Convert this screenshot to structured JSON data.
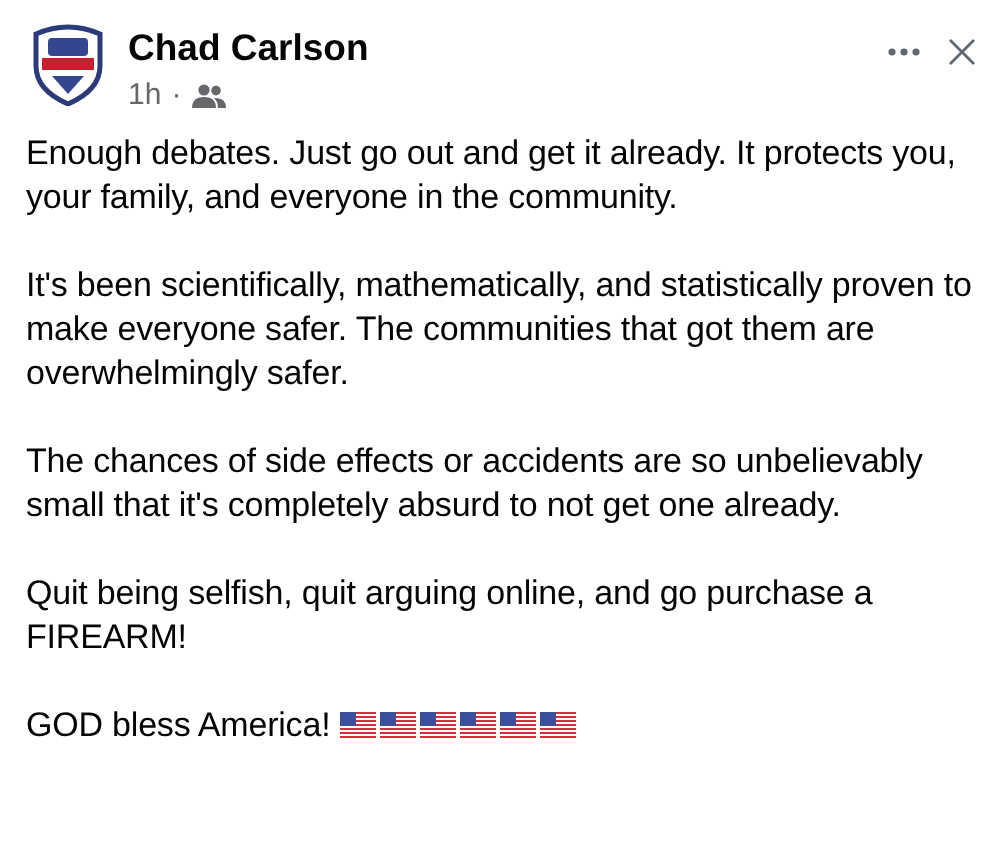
{
  "post": {
    "author": "Chad Carlson",
    "time": "1h",
    "separator": "·",
    "paragraphs": [
      "Enough debates. Just go out and get it already. It protects you, your family, and everyone in the community.",
      "It's been scientifically, mathematically, and statistically proven to make everyone safer. The communities that got them are overwhelmingly safer.",
      "The chances of side effects or accidents are so unbelievably small that it's completely absurd to not get one already.",
      "Quit being selfish, quit arguing online, and go purchase a FIREARM!"
    ],
    "closing": "GOD bless America!",
    "emojis": [
      {
        "kind": "us_flag"
      },
      {
        "kind": "us_flag"
      },
      {
        "kind": "us_flag"
      },
      {
        "kind": "us_flag"
      },
      {
        "kind": "us_flag"
      },
      {
        "kind": "us_flag"
      }
    ]
  }
}
